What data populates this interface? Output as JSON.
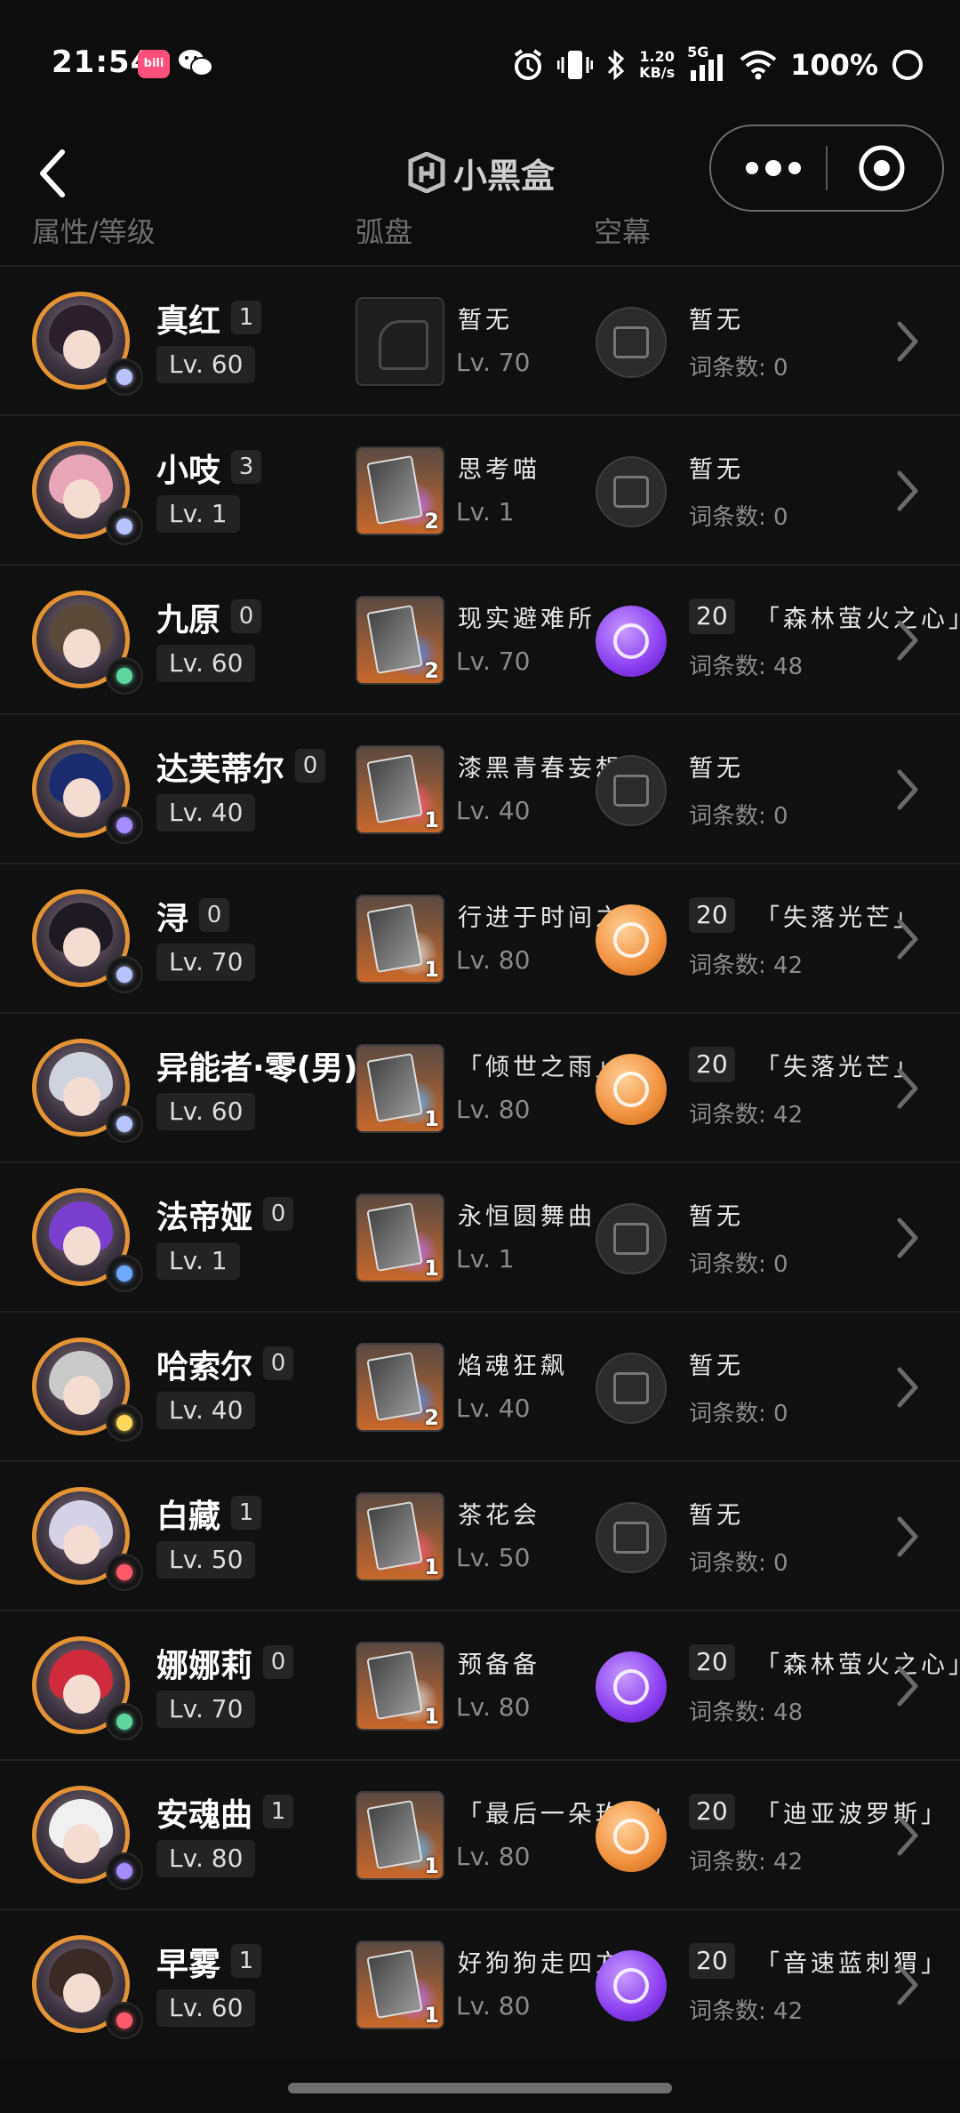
{
  "status_bar": {
    "time": "21:54",
    "app_badge": "bilibili",
    "speed_value": "1.20",
    "speed_unit": "KB/s",
    "network": "5G",
    "battery": "100%"
  },
  "nav": {
    "title": "小黑盒"
  },
  "columns": {
    "attr": "属性/等级",
    "wengine": "弧盘",
    "module": "空幕"
  },
  "rows": [
    {
      "name": "真红",
      "rank": "1",
      "lv": "Lv. 60",
      "w_name": "暂无",
      "w_lv": "Lv. 70",
      "w_star": "",
      "w_empty": true,
      "m_type": "empty",
      "m_count": "",
      "m_name": "暂无",
      "m_words": "词条数: 0",
      "elem_color": "#b9c4ff",
      "hair": "#2a1f2b"
    },
    {
      "name": "小吱",
      "rank": "3",
      "lv": "Lv. 1",
      "w_name": "思考喵",
      "w_lv": "Lv. 1",
      "w_star": "2",
      "w_empty": false,
      "m_type": "empty",
      "m_count": "",
      "m_name": "暂无",
      "m_words": "词条数: 0",
      "elem_color": "#b9c4ff",
      "hair": "#e9a6b8"
    },
    {
      "name": "九原",
      "rank": "0",
      "lv": "Lv. 60",
      "w_name": "现实避难所",
      "w_lv": "Lv. 70",
      "w_star": "2",
      "w_empty": false,
      "m_type": "violet",
      "m_count": "20",
      "m_name": "「森林萤火之心」",
      "m_words": "词条数: 48",
      "elem_color": "#5fd6a0",
      "hair": "#5a4a3a"
    },
    {
      "name": "达芙蒂尔",
      "rank": "0",
      "lv": "Lv. 40",
      "w_name": "漆黑青春妄想",
      "w_lv": "Lv. 40",
      "w_star": "1",
      "w_empty": false,
      "m_type": "empty",
      "m_count": "",
      "m_name": "暂无",
      "m_words": "词条数: 0",
      "elem_color": "#a58cff",
      "hair": "#1b2c6e"
    },
    {
      "name": "浔",
      "rank": "0",
      "lv": "Lv. 70",
      "w_name": "行进于时间之外",
      "w_lv": "Lv. 80",
      "w_star": "1",
      "w_empty": false,
      "m_type": "orange",
      "m_count": "20",
      "m_name": "「失落光芒」",
      "m_words": "词条数: 42",
      "elem_color": "#b9c4ff",
      "hair": "#1e1a22"
    },
    {
      "name": "异能者·零(男)",
      "rank": "",
      "lv": "Lv. 60",
      "w_name": "「倾世之雨」",
      "w_lv": "Lv. 80",
      "w_star": "1",
      "w_empty": false,
      "m_type": "orange",
      "m_count": "20",
      "m_name": "「失落光芒」",
      "m_words": "词条数: 42",
      "elem_color": "#b9c4ff",
      "hair": "#cfd3dd"
    },
    {
      "name": "法帝娅",
      "rank": "0",
      "lv": "Lv. 1",
      "w_name": "永恒圆舞曲",
      "w_lv": "Lv. 1",
      "w_star": "1",
      "w_empty": false,
      "m_type": "empty",
      "m_count": "",
      "m_name": "暂无",
      "m_words": "词条数: 0",
      "elem_color": "#6fa8ff",
      "hair": "#7b3fd0"
    },
    {
      "name": "哈索尔",
      "rank": "0",
      "lv": "Lv. 40",
      "w_name": "焰魂狂飙",
      "w_lv": "Lv. 40",
      "w_star": "2",
      "w_empty": false,
      "m_type": "empty",
      "m_count": "",
      "m_name": "暂无",
      "m_words": "词条数: 0",
      "elem_color": "#ffd75a",
      "hair": "#c9c9c9"
    },
    {
      "name": "白藏",
      "rank": "1",
      "lv": "Lv. 50",
      "w_name": "茶花会",
      "w_lv": "Lv. 50",
      "w_star": "1",
      "w_empty": false,
      "m_type": "empty",
      "m_count": "",
      "m_name": "暂无",
      "m_words": "词条数: 0",
      "elem_color": "#ff5a6a",
      "hair": "#d5d2e6"
    },
    {
      "name": "娜娜莉",
      "rank": "0",
      "lv": "Lv. 70",
      "w_name": "预备备",
      "w_lv": "Lv. 80",
      "w_star": "1",
      "w_empty": false,
      "m_type": "violet",
      "m_count": "20",
      "m_name": "「森林萤火之心」",
      "m_words": "词条数: 48",
      "elem_color": "#5fd6a0",
      "hair": "#d02b3b"
    },
    {
      "name": "安魂曲",
      "rank": "1",
      "lv": "Lv. 80",
      "w_name": "「最后一朵玫瑰」",
      "w_lv": "Lv. 80",
      "w_star": "1",
      "w_empty": false,
      "m_type": "orange",
      "m_count": "20",
      "m_name": "「迪亚波罗斯」",
      "m_words": "词条数: 42",
      "elem_color": "#a58cff",
      "hair": "#f0f0f0"
    },
    {
      "name": "早雾",
      "rank": "1",
      "lv": "Lv. 60",
      "w_name": "好狗狗走四方",
      "w_lv": "Lv. 80",
      "w_star": "1",
      "w_empty": false,
      "m_type": "violet",
      "m_count": "20",
      "m_name": "「音速蓝刺猬」",
      "m_words": "词条数: 42",
      "elem_color": "#ff5a6a",
      "hair": "#3a2a25"
    }
  ],
  "colors": {
    "background": "#0d0d0d",
    "avatar_ring": "#e39334",
    "module_violet": "#8a3df0",
    "module_orange": "#f08f3a"
  }
}
